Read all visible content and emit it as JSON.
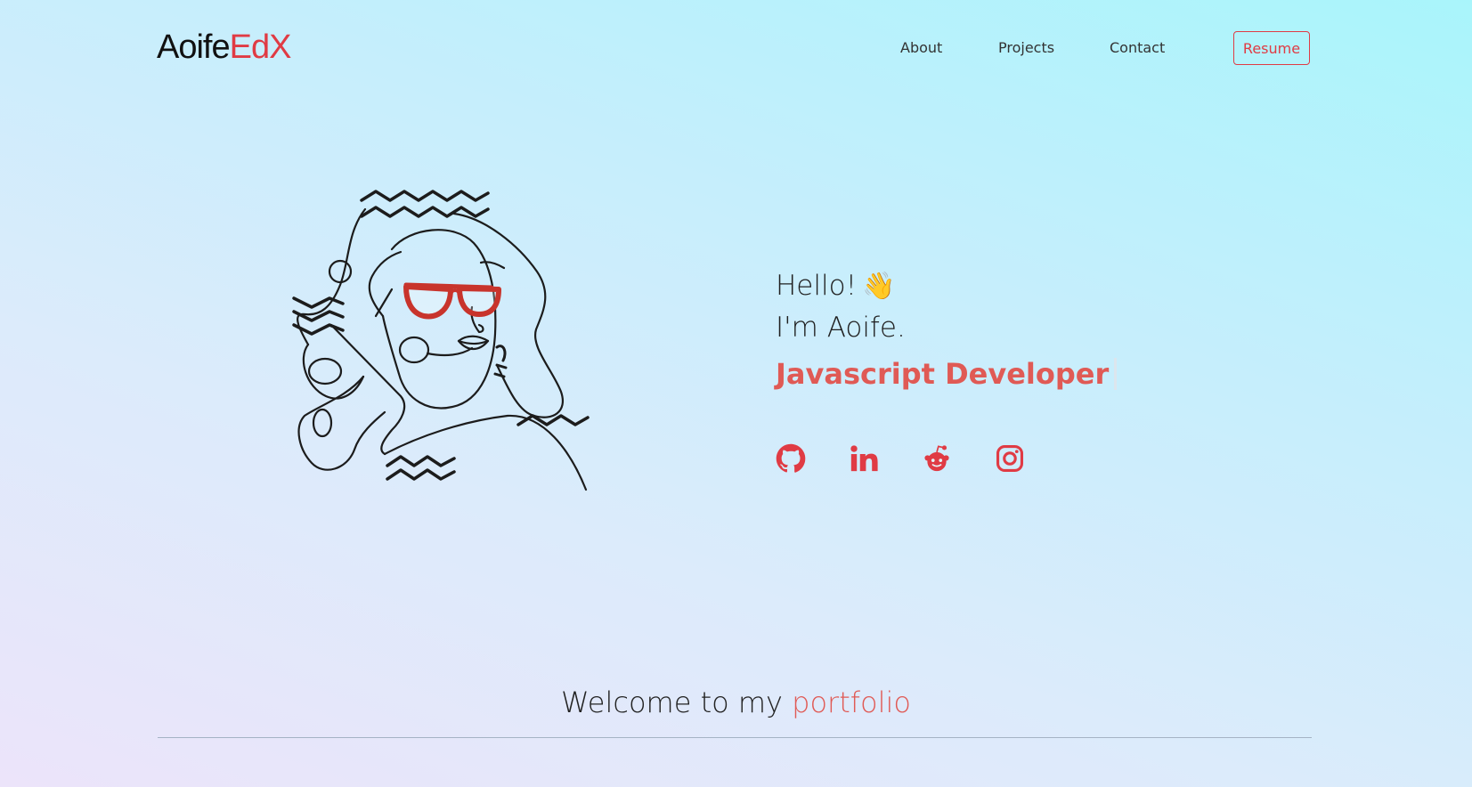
{
  "navbar": {
    "logo": {
      "first": "Aoife",
      "second": "EdX"
    },
    "links": [
      {
        "label": "About"
      },
      {
        "label": "Projects"
      },
      {
        "label": "Contact"
      }
    ],
    "resume_label": "Resume"
  },
  "hero": {
    "greeting": "Hello!",
    "greeting_icon": "waving-hand-emoji",
    "intro": "I'm Aoife.",
    "role": "Javascript Developer",
    "illustration": "line-art-woman-with-red-glasses",
    "socials": [
      {
        "icon": "github-icon"
      },
      {
        "icon": "linkedin-icon"
      },
      {
        "icon": "reddit-icon"
      },
      {
        "icon": "instagram-icon"
      }
    ]
  },
  "welcome": {
    "prefix": "Welcome to my",
    "highlight": "portfolio"
  },
  "colors": {
    "accent": "#e03b44",
    "accent_soft": "#e05a55",
    "text": "#1f1f1f"
  }
}
